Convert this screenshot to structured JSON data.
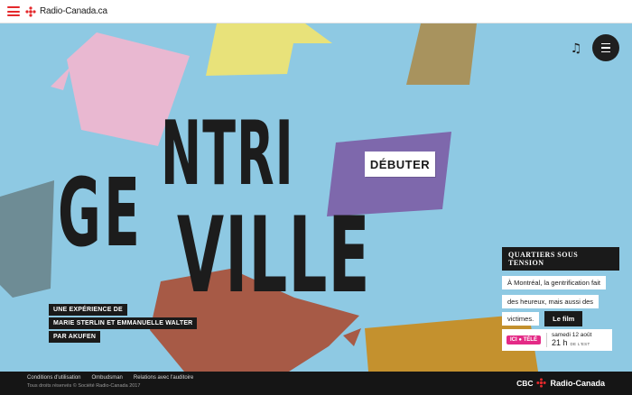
{
  "header": {
    "brand_text": "Radio-Canada.ca"
  },
  "hero": {
    "word_line1": "NTRI",
    "word_line2": "GE",
    "word_line3": "VILLE",
    "start_label": "DÉBUTER"
  },
  "controls": {
    "music_glyph": "♫"
  },
  "credits": {
    "lines": [
      "UNE EXPÉRIENCE DE",
      "MARIE STERLIN ET EMMANUELLE WALTER",
      "PAR AKUFEN"
    ]
  },
  "panel": {
    "title": "QUARTIERS SOUS TENSION",
    "desc_lines": [
      "À Montréal, la gentrification fait",
      "des heureux, mais aussi des",
      "victimes."
    ],
    "film_label": "Le film",
    "tele": {
      "logo": "ICI ● TÉLÉ",
      "date": "samedi 12 août",
      "time": "21 h",
      "zone": "DE L'EST"
    }
  },
  "footer": {
    "links": [
      "Conditions d'utilisation",
      "Ombudsman",
      "Relations avec l'auditoire"
    ],
    "copyright": "Tous droits réservés © Société Radio-Canada 2017",
    "cbc": "CBC",
    "radio_canada": "Radio-Canada"
  },
  "colors": {
    "background": "#8ec9e3",
    "pink": "#e9b8d1",
    "yellow": "#e8e27a",
    "brown": "#a8935e",
    "purple": "#7e68ac",
    "slate": "#6e8c95",
    "rust": "#a75a46",
    "ochre": "#c4912e",
    "brand_red": "#e4292c"
  }
}
